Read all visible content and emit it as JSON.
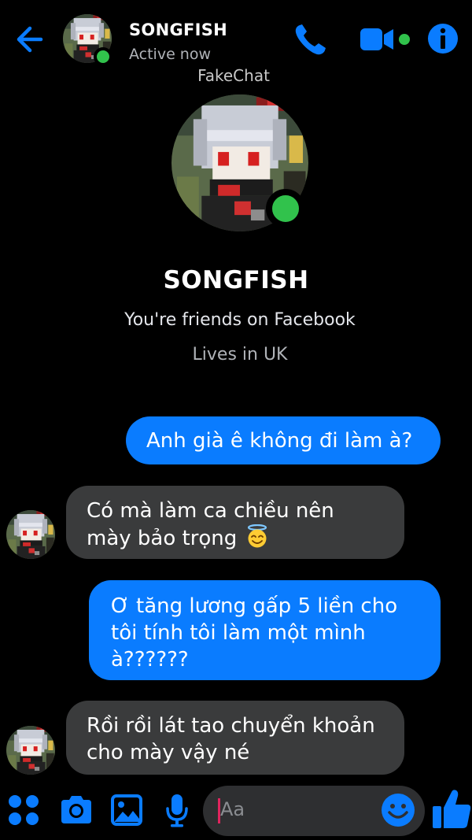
{
  "header": {
    "name": "SONGFISH",
    "status": "Active now"
  },
  "watermark": "FakeChat",
  "profile": {
    "name": "SONGFISH",
    "friends_text": "You're friends on Facebook",
    "lives_text": "Lives in UK"
  },
  "messages": [
    {
      "sender": "me",
      "lines": [
        "Anh già ê không đi làm à?"
      ]
    },
    {
      "sender": "SONGFISH",
      "lines": [
        "Có mà làm ca chiều nên",
        "mày bảo trọng"
      ],
      "emoji": "smiling-face-with-halo"
    },
    {
      "sender": "me",
      "lines": [
        "Ơ tăng lương gấp 5 liền cho",
        "tôi tính tôi làm một mình",
        "à??????"
      ]
    },
    {
      "sender": "SONGFISH",
      "lines": [
        "Rồi rồi lát tao chuyển khoản",
        "cho mày vậy né"
      ]
    }
  ],
  "composer": {
    "placeholder": "Aa"
  },
  "colors": {
    "accent": "#0a7cff",
    "background": "#000000",
    "incoming_bubble": "#3a3b3c",
    "online_dot": "#31c24c"
  },
  "icons": [
    "back-arrow-icon",
    "phone-icon",
    "video-camera-icon",
    "info-icon",
    "apps-grid-icon",
    "camera-icon",
    "image-icon",
    "microphone-icon",
    "emoji-icon",
    "thumbs-up-icon"
  ]
}
